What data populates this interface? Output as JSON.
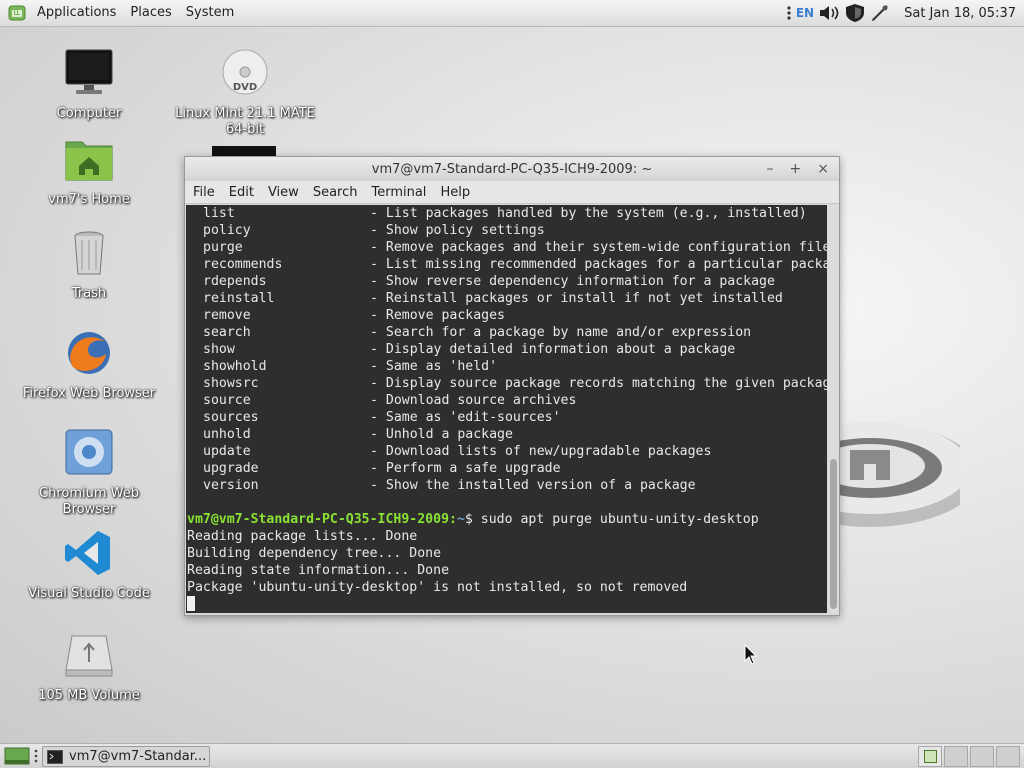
{
  "top_panel": {
    "menus": [
      "Applications",
      "Places",
      "System"
    ],
    "lang": "EN",
    "clock": "Sat Jan 18, 05:37"
  },
  "desktop_icons": [
    {
      "label": "Computer"
    },
    {
      "label": "vm7's Home"
    },
    {
      "label": "Trash"
    },
    {
      "label": "Firefox Web Browser"
    },
    {
      "label": "Chromium Web Browser"
    },
    {
      "label": "Visual Studio Code"
    },
    {
      "label": "105 MB Volume"
    },
    {
      "label": "Linux Mint 21.1 MATE 64-bit"
    }
  ],
  "terminal": {
    "title": "vm7@vm7-Standard-PC-Q35-ICH9-2009: ~",
    "menu": [
      "File",
      "Edit",
      "View",
      "Search",
      "Terminal",
      "Help"
    ],
    "help_lines": [
      {
        "cmd": "list",
        "desc": "- List packages handled by the system (e.g., installed)"
      },
      {
        "cmd": "policy",
        "desc": "- Show policy settings"
      },
      {
        "cmd": "purge",
        "desc": "- Remove packages and their system-wide configuration files"
      },
      {
        "cmd": "recommends",
        "desc": "- List missing recommended packages for a particular package"
      },
      {
        "cmd": "rdepends",
        "desc": "- Show reverse dependency information for a package"
      },
      {
        "cmd": "reinstall",
        "desc": "- Reinstall packages or install if not yet installed"
      },
      {
        "cmd": "remove",
        "desc": "- Remove packages"
      },
      {
        "cmd": "search",
        "desc": "- Search for a package by name and/or expression"
      },
      {
        "cmd": "show",
        "desc": "- Display detailed information about a package"
      },
      {
        "cmd": "showhold",
        "desc": "- Same as 'held'"
      },
      {
        "cmd": "showsrc",
        "desc": "- Display source package records matching the given package"
      },
      {
        "cmd": "source",
        "desc": "- Download source archives"
      },
      {
        "cmd": "sources",
        "desc": "- Same as 'edit-sources'"
      },
      {
        "cmd": "unhold",
        "desc": "- Unhold a package"
      },
      {
        "cmd": "update",
        "desc": "- Download lists of new/upgradable packages"
      },
      {
        "cmd": "upgrade",
        "desc": "- Perform a safe upgrade"
      },
      {
        "cmd": "version",
        "desc": "- Show the installed version of a package"
      }
    ],
    "prompt": "vm7@vm7-Standard-PC-Q35-ICH9-2009:",
    "prompt_path": "~",
    "prompt_symbol": "$",
    "command": " sudo apt purge ubuntu-unity-desktop",
    "output": [
      "Reading package lists... Done",
      "Building dependency tree... Done",
      "Reading state information... Done",
      "Package 'ubuntu-unity-desktop' is not installed, so not removed"
    ]
  },
  "taskbar": {
    "window_button": "vm7@vm7-Standar..."
  },
  "colors": {
    "prompt_green": "#8ae234",
    "prompt_path_blue": "#729fcf",
    "terminal_bg": "#2e2e2e"
  }
}
